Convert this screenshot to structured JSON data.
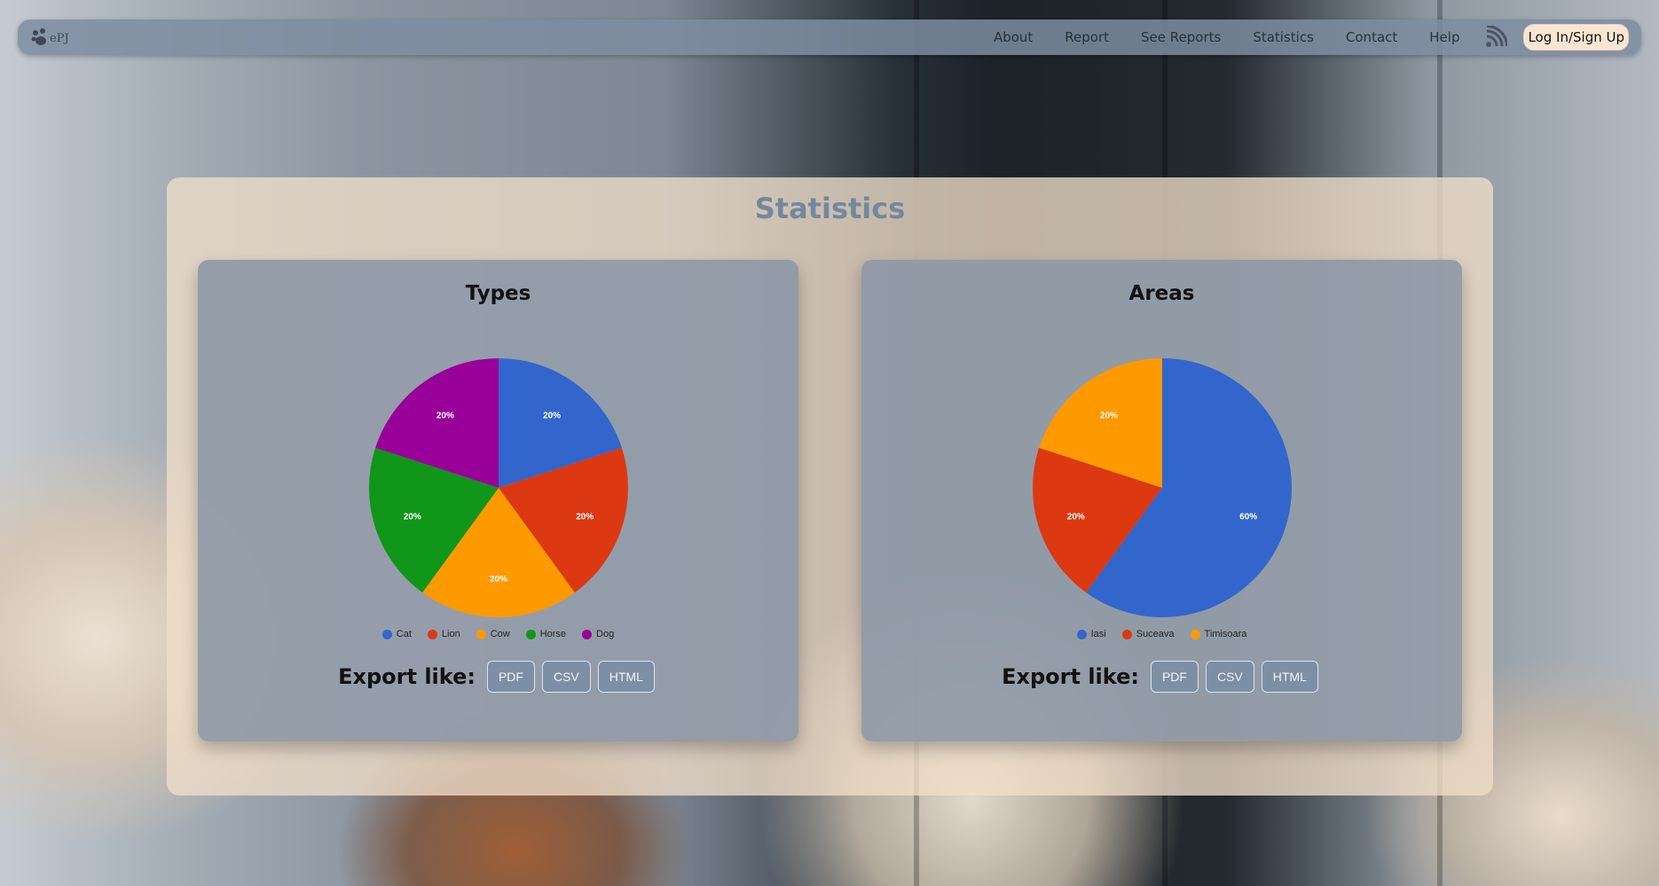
{
  "nav": {
    "logo_text": "ePJ",
    "links": [
      "About",
      "Report",
      "See Reports",
      "Statistics",
      "Contact",
      "Help"
    ],
    "login_label": "Log In/Sign Up"
  },
  "page": {
    "title": "Statistics"
  },
  "charts": [
    {
      "title": "Types",
      "export_label": "Export like:",
      "export_buttons": [
        "PDF",
        "CSV",
        "HTML"
      ]
    },
    {
      "title": "Areas",
      "export_label": "Export like:",
      "export_buttons": [
        "PDF",
        "CSV",
        "HTML"
      ]
    }
  ],
  "chart_data": [
    {
      "type": "pie",
      "title": "Types",
      "categories": [
        "Cat",
        "Lion",
        "Cow",
        "Horse",
        "Dog"
      ],
      "values": [
        20,
        20,
        20,
        20,
        20
      ],
      "labels": [
        "20%",
        "20%",
        "20%",
        "20%",
        "20%"
      ],
      "colors": [
        "#3366cc",
        "#dc3912",
        "#ff9900",
        "#109618",
        "#990099"
      ],
      "legend_position": "bottom"
    },
    {
      "type": "pie",
      "title": "Areas",
      "categories": [
        "Iasi",
        "Suceava",
        "Timisoara"
      ],
      "values": [
        60,
        20,
        20
      ],
      "labels": [
        "60%",
        "20%",
        "20%"
      ],
      "colors": [
        "#3366cc",
        "#dc3912",
        "#ff9900"
      ],
      "legend_position": "bottom"
    }
  ],
  "icons": {
    "rss": "rss-icon",
    "logo": "paw-logo-icon"
  }
}
